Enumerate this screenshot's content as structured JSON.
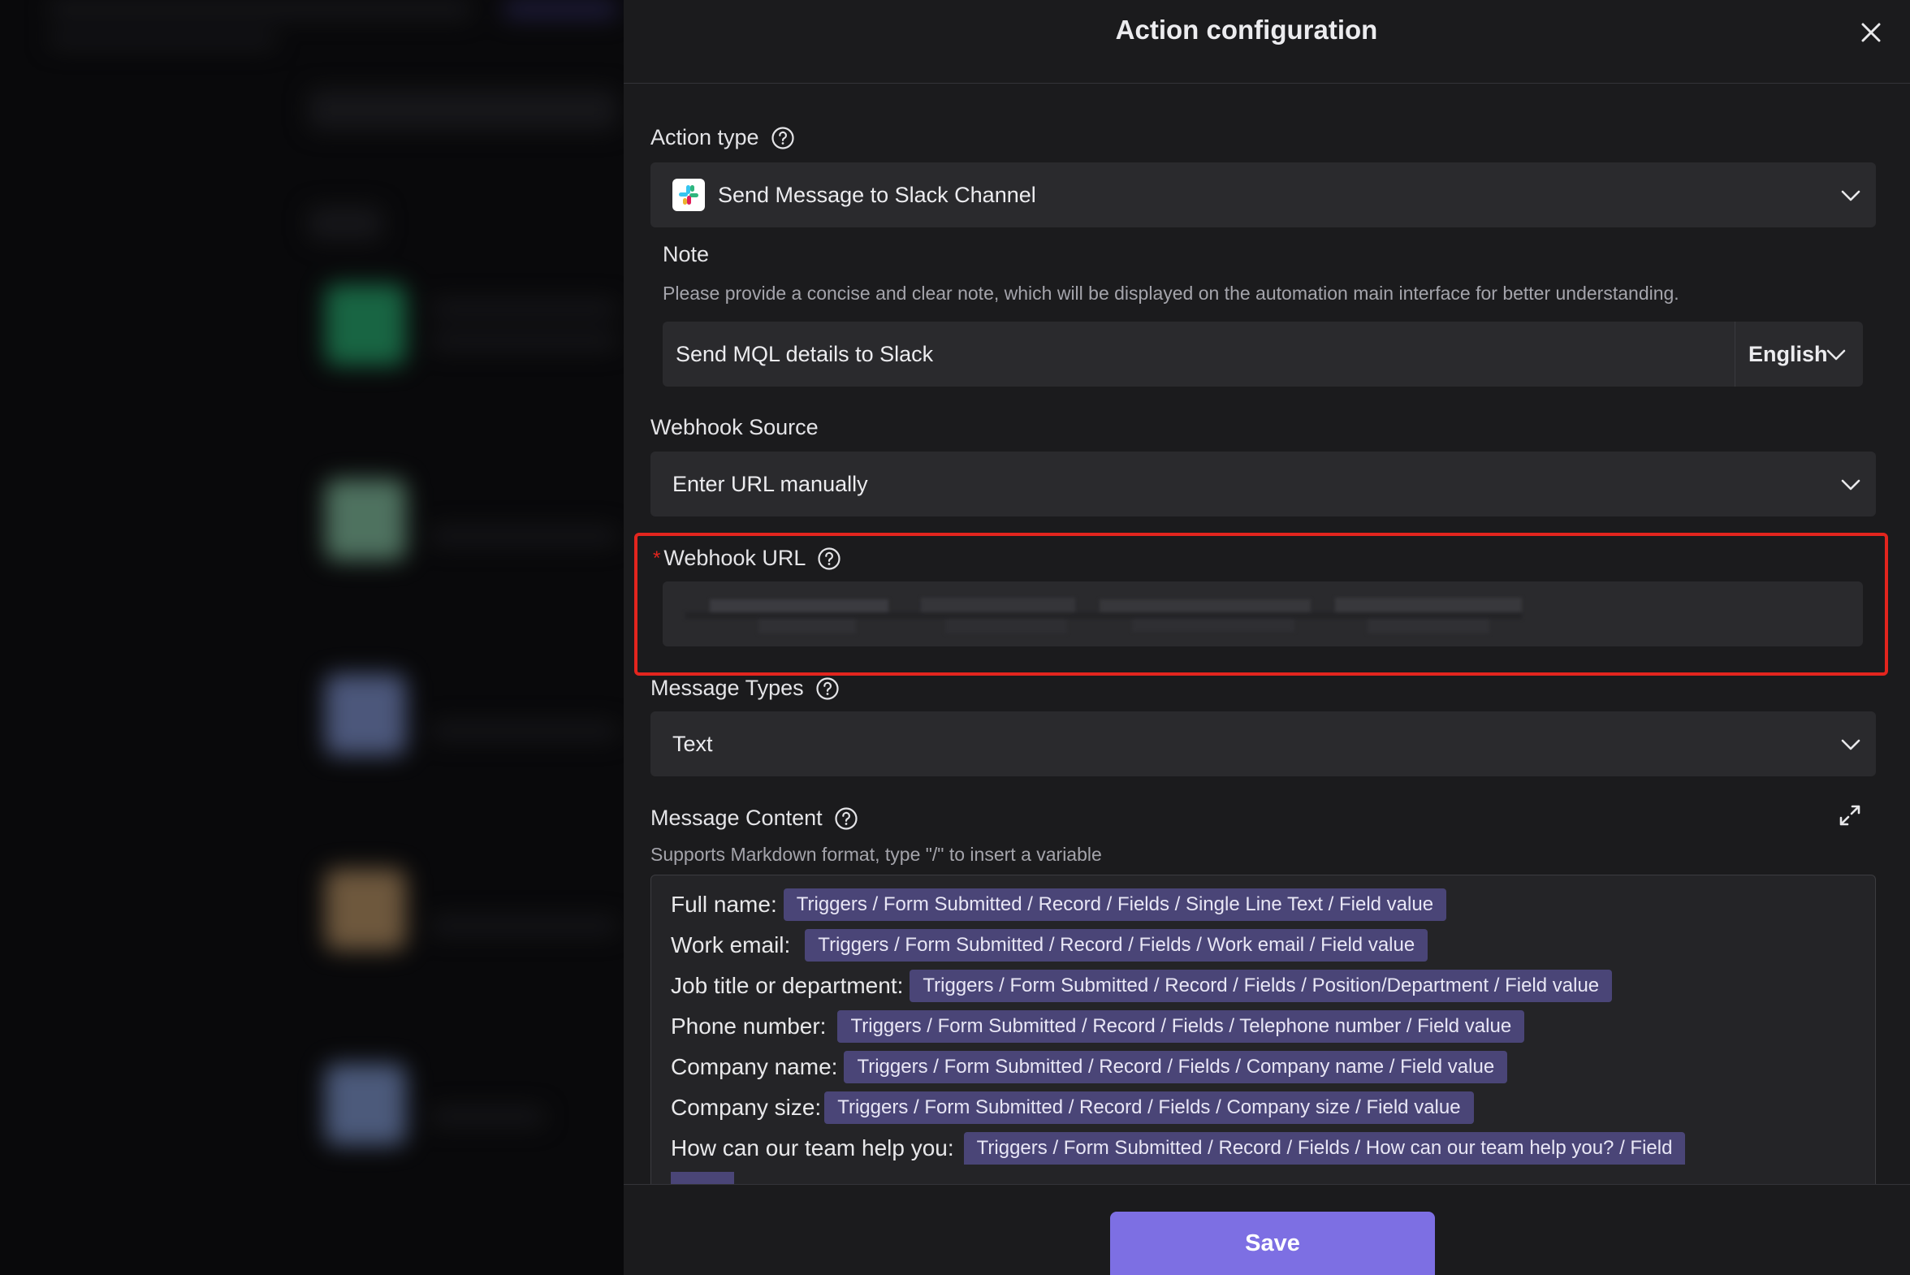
{
  "panel": {
    "title": "Action configuration"
  },
  "action_type": {
    "label": "Action type",
    "value": "Send Message to Slack Channel",
    "icon": "slack-icon"
  },
  "note": {
    "label": "Note",
    "hint": "Please provide a concise and clear note, which will be displayed on the automation main interface for better understanding.",
    "value": "Send MQL details to Slack",
    "language": "English"
  },
  "webhook_source": {
    "label": "Webhook Source",
    "value": "Enter URL manually"
  },
  "webhook_url": {
    "required_mark": "*",
    "label": "Webhook URL",
    "highlight_color": "#e3251e"
  },
  "message_types": {
    "label": "Message Types",
    "value": "Text"
  },
  "message_content": {
    "label": "Message Content",
    "hint": "Supports Markdown format, type \"/\" to insert a variable",
    "lines": [
      {
        "key": "Full name:",
        "chip": "Triggers / Form Submitted / Record / Fields / Single Line Text / Field value"
      },
      {
        "key": "Work email:",
        "chip": "Triggers / Form Submitted / Record / Fields / Work email / Field value"
      },
      {
        "key": "Job title or department:",
        "chip": "Triggers / Form Submitted / Record / Fields / Position/Department / Field value"
      },
      {
        "key": "Phone number:",
        "chip": "Triggers / Form Submitted / Record / Fields / Telephone number / Field value"
      },
      {
        "key": "Company name:",
        "chip": "Triggers / Form Submitted / Record / Fields / Company name / Field value"
      },
      {
        "key": "Company size:",
        "chip": "Triggers / Form Submitted / Record / Fields / Company size / Field value"
      },
      {
        "key": "How can our team help you:",
        "chip": "Triggers / Form Submitted / Record / Fields / How can our team help you? / Field"
      }
    ]
  },
  "footer": {
    "save_label": "Save",
    "accent_color": "#7d6fe3"
  }
}
